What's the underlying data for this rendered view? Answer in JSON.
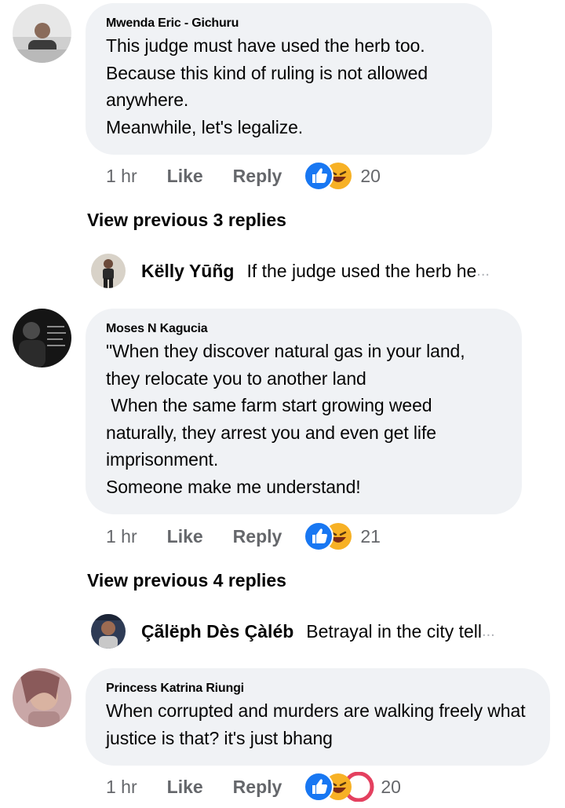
{
  "comments": [
    {
      "author": "Mwenda Eric - Gichuru",
      "text": "This judge must have used the herb too.\nBecause this kind of ruling is not allowed anywhere.\nMeanwhile, let's legalize.",
      "time": "1 hr",
      "like_label": "Like",
      "reply_label": "Reply",
      "reaction_count": "20",
      "reactions": [
        "like-icon",
        "haha-icon"
      ],
      "view_previous": "View previous 3 replies",
      "reply_preview": {
        "name": "Këlly Yūñg",
        "text": "If the judge used the herb he",
        "ellipsis": "..."
      }
    },
    {
      "author": "Moses N Kagucia",
      "text": "\"When they discover natural gas in your land,\nthey relocate you to another land\n When the same farm start growing weed naturally, they arrest you and even get life imprisonment.\nSomeone make me understand!",
      "time": "1 hr",
      "like_label": "Like",
      "reply_label": "Reply",
      "reaction_count": "21",
      "reactions": [
        "like-icon",
        "haha-icon"
      ],
      "view_previous": "View previous 4 replies",
      "reply_preview": {
        "name": "Çãlëph Dès Çàléb",
        "text": "Betrayal in the city tell",
        "ellipsis": "..."
      }
    },
    {
      "author": "Princess Katrina Riungi",
      "text": "When corrupted and murders are walking freely what justice is that? it's just bhang",
      "time": "1 hr",
      "like_label": "Like",
      "reply_label": "Reply",
      "reaction_count": "20",
      "reactions": [
        "like-icon",
        "haha-icon",
        "sad-icon"
      ]
    }
  ],
  "colors": {
    "like_blue": "#1877f2",
    "haha_yellow": "#f7b125",
    "sad_red": "#e4405f",
    "bubble_bg": "#f0f2f5",
    "meta_gray": "#65676b"
  }
}
